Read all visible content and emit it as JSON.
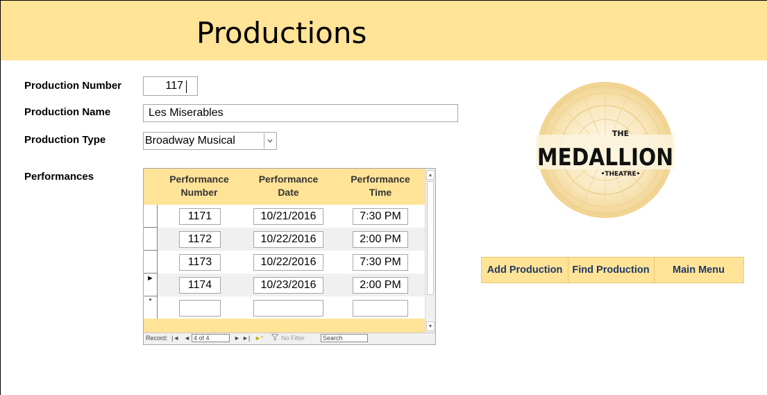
{
  "header": {
    "title": "Productions"
  },
  "form": {
    "production_number": {
      "label": "Production Number",
      "value": "117"
    },
    "production_name": {
      "label": "Production Name",
      "value": "Les Miserables"
    },
    "production_type": {
      "label": "Production Type",
      "value": "Broadway Musical"
    },
    "performances_label": "Performances"
  },
  "subform": {
    "columns": [
      {
        "line1": "Performance",
        "line2": "Number"
      },
      {
        "line1": "Performance",
        "line2": "Date"
      },
      {
        "line1": "Performance",
        "line2": "Time"
      }
    ],
    "rows": [
      {
        "number": "1171",
        "date": "10/21/2016",
        "time": "7:30 PM",
        "selector": ""
      },
      {
        "number": "1172",
        "date": "10/22/2016",
        "time": "2:00 PM",
        "selector": ""
      },
      {
        "number": "1173",
        "date": "10/22/2016",
        "time": "7:30 PM",
        "selector": ""
      },
      {
        "number": "1174",
        "date": "10/23/2016",
        "time": "2:00 PM",
        "selector": "►"
      }
    ],
    "new_row_selector": "*",
    "navigation": {
      "record_label": "Record:",
      "first": "|◄",
      "prev": "◄",
      "position": "4 of 4",
      "next": "►",
      "last": "►|",
      "new": "►*",
      "filter": "No Filter",
      "search_placeholder": "Search"
    }
  },
  "logo": {
    "line1": "THE",
    "line2": "MEDALLION",
    "line3": "•THEATRE•"
  },
  "buttons": {
    "add_production": "Add Production",
    "find_production": "Find Production",
    "main_menu": "Main Menu"
  },
  "colors": {
    "header_band": "#ffe397",
    "button_text": "#1f3864",
    "logo_gold": "#e8c46a"
  },
  "icons": {
    "combo_dropdown": "chevron-down-icon",
    "record_selector": "triangle-right-icon",
    "new_record": "asterisk-icon",
    "filter": "funnel-icon"
  }
}
